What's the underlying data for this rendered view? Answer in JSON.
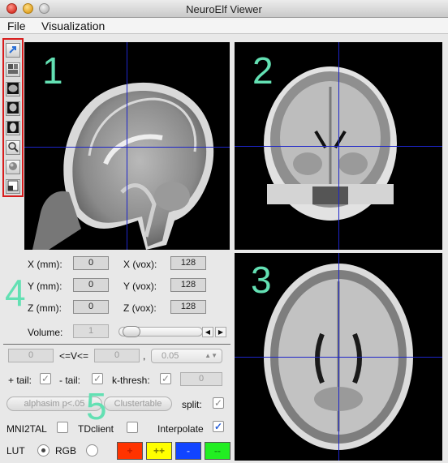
{
  "window": {
    "title": "NeuroElf Viewer"
  },
  "menu": {
    "items": [
      {
        "label": "File"
      },
      {
        "label": "Visualization"
      }
    ]
  },
  "toolbar": {
    "tools": [
      {
        "name": "pointer-tool-icon"
      },
      {
        "name": "multi-slice-icon"
      },
      {
        "name": "sagittal-view-icon"
      },
      {
        "name": "coronal-view-icon"
      },
      {
        "name": "axial-view-icon"
      },
      {
        "name": "zoom-icon"
      },
      {
        "name": "render-icon"
      },
      {
        "name": "window-layout-icon"
      }
    ],
    "highlight_color": "#d81c1c"
  },
  "views": [
    {
      "number": "1",
      "orientation": "sagittal"
    },
    {
      "number": "2",
      "orientation": "coronal"
    },
    {
      "number": "3",
      "orientation": "axial"
    }
  ],
  "annotations": {
    "coords_group": "4",
    "stats_group": "5",
    "color": "#63e0b3"
  },
  "crosshair_color": "#1d25c8",
  "coords": {
    "x_mm_label": "X (mm):",
    "x_mm": "0",
    "y_mm_label": "Y (mm):",
    "y_mm": "0",
    "z_mm_label": "Z (mm):",
    "z_mm": "0",
    "x_vox_label": "X (vox):",
    "x_vox": "128",
    "y_vox_label": "Y (vox):",
    "y_vox": "128",
    "z_vox_label": "Z (vox):",
    "z_vox": "128"
  },
  "volume": {
    "label": "Volume:",
    "value": "1"
  },
  "threshold": {
    "lower": "0",
    "between_label": "<=V<=",
    "upper": "0",
    "comma": ",",
    "pvalue": "0.05"
  },
  "tails": {
    "pos_label": "+ tail:",
    "neg_label": "- tail:",
    "kthresh_label": "k-thresh:",
    "kthresh_value": "0",
    "check_mark": "✓"
  },
  "buttons": {
    "alphasim": "alphasim p<.05",
    "clustertable": "Clustertable",
    "split_label": "split:"
  },
  "options": {
    "mni2tal": "MNI2TAL",
    "tdclient": "TDclient",
    "interpolate": "Interpolate"
  },
  "lut": {
    "label": "LUT",
    "rgb_label": "RGB",
    "buttons": [
      {
        "label": "+",
        "color": "#ff3300",
        "text_color": "#c01c00"
      },
      {
        "label": "++",
        "color": "#ffff00",
        "text_color": "#777700"
      },
      {
        "label": "-",
        "color": "#1144ff",
        "text_color": "#9fb4ff"
      },
      {
        "label": "--",
        "color": "#22ee22",
        "text_color": "#119911"
      }
    ]
  }
}
